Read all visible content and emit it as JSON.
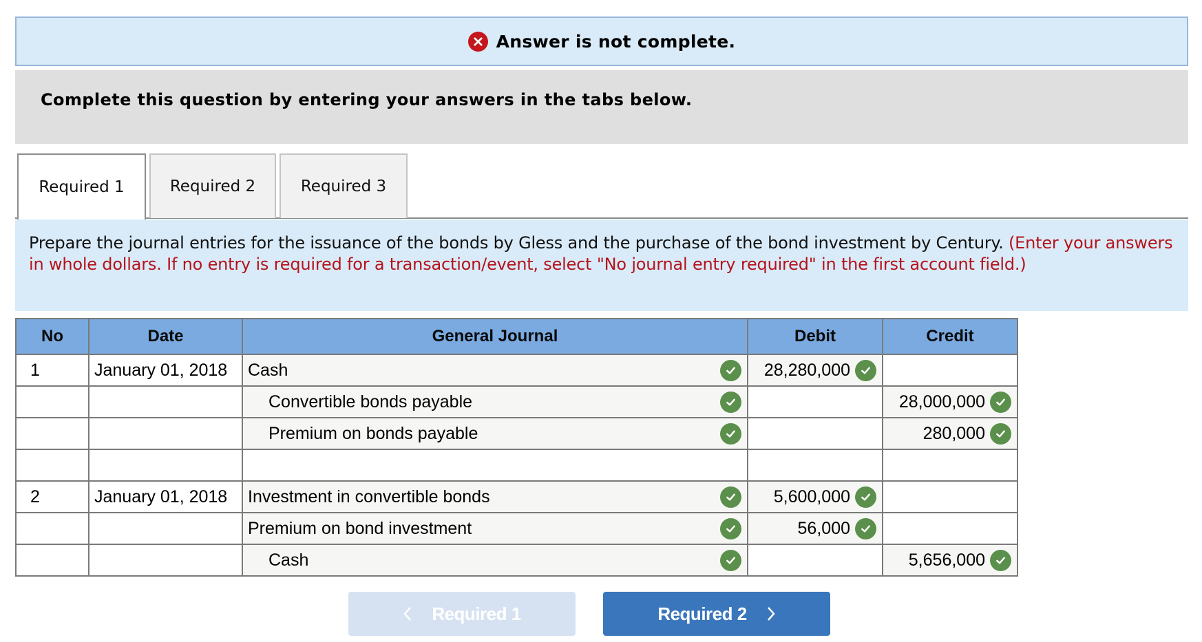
{
  "banner": {
    "icon": "error-x-icon",
    "message": "Answer is not complete."
  },
  "prompt": "Complete this question by entering your answers in the tabs below.",
  "tabs": [
    {
      "label": "Required 1",
      "active": true
    },
    {
      "label": "Required 2",
      "active": false
    },
    {
      "label": "Required 3",
      "active": false
    }
  ],
  "instructions": {
    "text": "Prepare the journal entries for the issuance of the bonds by Gless and the purchase of the bond investment by Century.",
    "note": "(Enter your answers in whole dollars. If no entry is required for a transaction/event, select \"No journal entry required\" in the first account field.)"
  },
  "journal": {
    "headers": {
      "no": "No",
      "date": "Date",
      "general_journal": "General Journal",
      "debit": "Debit",
      "credit": "Credit"
    },
    "rows": [
      {
        "no": "1",
        "date": "January 01, 2018",
        "account": "Cash",
        "indent": false,
        "debit": "28,280,000",
        "credit": "",
        "account_check": true,
        "debit_check": true,
        "credit_check": false
      },
      {
        "no": "",
        "date": "",
        "account": "Convertible bonds payable",
        "indent": true,
        "debit": "",
        "credit": "28,000,000",
        "account_check": true,
        "debit_check": false,
        "credit_check": true
      },
      {
        "no": "",
        "date": "",
        "account": "Premium on bonds payable",
        "indent": true,
        "debit": "",
        "credit": "280,000",
        "account_check": true,
        "debit_check": false,
        "credit_check": true
      },
      {
        "no": "",
        "date": "",
        "account": "",
        "indent": false,
        "debit": "",
        "credit": "",
        "account_check": false,
        "debit_check": false,
        "credit_check": false
      },
      {
        "no": "2",
        "date": "January 01, 2018",
        "account": "Investment in convertible bonds",
        "indent": false,
        "debit": "5,600,000",
        "credit": "",
        "account_check": true,
        "debit_check": true,
        "credit_check": false
      },
      {
        "no": "",
        "date": "",
        "account": "Premium on bond investment",
        "indent": false,
        "debit": "56,000",
        "credit": "",
        "account_check": true,
        "debit_check": true,
        "credit_check": false
      },
      {
        "no": "",
        "date": "",
        "account": "Cash",
        "indent": true,
        "debit": "",
        "credit": "5,656,000",
        "account_check": true,
        "debit_check": false,
        "credit_check": true
      }
    ]
  },
  "navigation": {
    "prev_label": "Required 1",
    "prev_enabled": false,
    "next_label": "Required 2",
    "next_enabled": true
  },
  "colors": {
    "error": "#c4161c",
    "correct": "#5b8f4c",
    "header": "#7aaae0",
    "primary_button": "#3a76bc",
    "note_text": "#b5131b"
  }
}
